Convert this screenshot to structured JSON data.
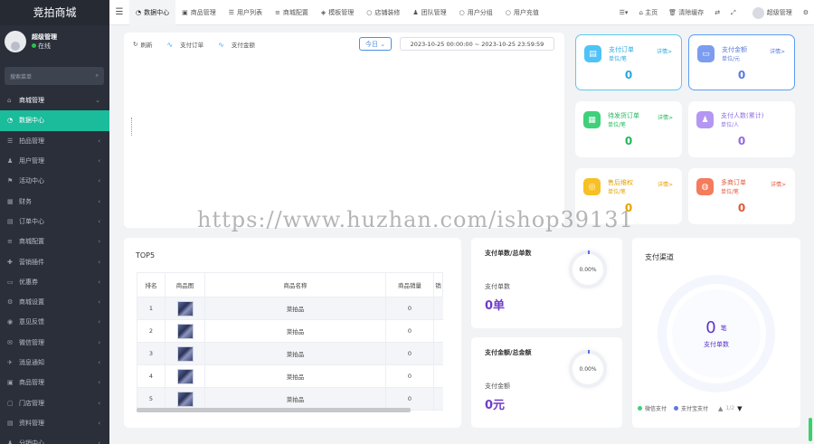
{
  "app": {
    "title": "竞拍商城"
  },
  "user": {
    "name": "超级管理",
    "status": "在线"
  },
  "sidebar": {
    "search_placeholder": "搜索菜单",
    "items": [
      {
        "icon": "home-icon",
        "glyph": "⌂",
        "label": "商城管理",
        "type": "head"
      },
      {
        "icon": "dashboard-icon",
        "glyph": "◔",
        "label": "数据中心",
        "type": "active"
      },
      {
        "icon": "list-icon",
        "glyph": "☰",
        "label": "拍品管理",
        "type": ""
      },
      {
        "icon": "user-icon",
        "glyph": "♟",
        "label": "用户管理",
        "type": ""
      },
      {
        "icon": "flag-icon",
        "glyph": "⚑",
        "label": "活动中心",
        "type": ""
      },
      {
        "icon": "grid-icon",
        "glyph": "▦",
        "label": "财务",
        "type": ""
      },
      {
        "icon": "file-icon",
        "glyph": "▤",
        "label": "订单中心",
        "type": ""
      },
      {
        "icon": "config-icon",
        "glyph": "≡",
        "label": "商城配置",
        "type": ""
      },
      {
        "icon": "gift-icon",
        "glyph": "✚",
        "label": "营销插件",
        "type": ""
      },
      {
        "icon": "ticket-icon",
        "glyph": "▭",
        "label": "优惠券",
        "type": ""
      },
      {
        "icon": "settings-icon",
        "glyph": "⚙",
        "label": "商城设置",
        "type": ""
      },
      {
        "icon": "feedback-icon",
        "glyph": "◉",
        "label": "意见反馈",
        "type": ""
      },
      {
        "icon": "wechat-icon",
        "glyph": "✉",
        "label": "微信管理",
        "type": ""
      },
      {
        "icon": "bell-icon",
        "glyph": "✈",
        "label": "消息通知",
        "type": ""
      },
      {
        "icon": "box-icon",
        "glyph": "▣",
        "label": "商品管理",
        "type": ""
      },
      {
        "icon": "store-icon",
        "glyph": "▢",
        "label": "门店管理",
        "type": ""
      },
      {
        "icon": "doc-icon",
        "glyph": "▤",
        "label": "资料管理",
        "type": ""
      },
      {
        "icon": "team-icon",
        "glyph": "♟",
        "label": "分销中心",
        "type": ""
      }
    ]
  },
  "topbar": {
    "tabs": [
      {
        "icon": "dashboard-icon",
        "glyph": "◔",
        "label": "数据中心",
        "active": true
      },
      {
        "icon": "box-icon",
        "glyph": "▣",
        "label": "商品管理"
      },
      {
        "icon": "list-icon",
        "glyph": "☰",
        "label": "用户列表"
      },
      {
        "icon": "sliders-icon",
        "glyph": "≡",
        "label": "商城配置"
      },
      {
        "icon": "template-icon",
        "glyph": "◈",
        "label": "模板管理"
      },
      {
        "icon": "circle-icon",
        "glyph": "○",
        "label": "店铺装修"
      },
      {
        "icon": "team-icon",
        "glyph": "♟",
        "label": "团队管理"
      },
      {
        "icon": "circle-icon",
        "glyph": "○",
        "label": "用户分组"
      },
      {
        "icon": "circle-icon",
        "glyph": "○",
        "label": "用户充值"
      }
    ],
    "home_label": "主页",
    "clear_cache_label": "清除缓存",
    "admin_label": "超级管理"
  },
  "chart": {
    "refresh_label": "刷新",
    "series1": "支付订单",
    "series2": "支付金额",
    "today_label": "今日",
    "date_range": "2023-10-25 00:00:00  ~  2023-10-25 23:59:59"
  },
  "stats": [
    {
      "title": "支付订单",
      "unit": "单位/笔",
      "detail": "详情>",
      "value": "0",
      "color": "#4fc3f7",
      "text_color": "#29a9e0",
      "glyph": "▤",
      "icon": "order-icon",
      "selected": "sel1"
    },
    {
      "title": "支付金额",
      "unit": "单位/元",
      "detail": "详情>",
      "value": "0",
      "color": "#7c9cf0",
      "text_color": "#5b7bdc",
      "glyph": "▭",
      "icon": "wallet-icon",
      "selected": "sel2"
    },
    {
      "title": "待发货订单",
      "unit": "单位/笔",
      "detail": "详情>",
      "value": "0",
      "color": "#3ed07a",
      "text_color": "#20b85c",
      "glyph": "▦",
      "icon": "shipping-icon",
      "selected": ""
    },
    {
      "title": "支付人数(累计)",
      "unit": "单位/人",
      "detail": "",
      "value": "0",
      "color": "#b497f2",
      "text_color": "#8f6be0",
      "glyph": "♟",
      "icon": "people-icon",
      "selected": ""
    },
    {
      "title": "售后维权",
      "unit": "单位/笔",
      "detail": "详情>",
      "value": "0",
      "color": "#f6c026",
      "text_color": "#e3a200",
      "glyph": "◎",
      "icon": "aftersale-icon",
      "selected": ""
    },
    {
      "title": "多商订单",
      "unit": "单位/笔",
      "detail": "详情>",
      "value": "0",
      "color": "#f47c5c",
      "text_color": "#e05a38",
      "glyph": "◍",
      "icon": "merchant-icon",
      "selected": ""
    }
  ],
  "top5": {
    "title": "TOP5",
    "columns": [
      "排名",
      "商品图",
      "商品名称",
      "商品销量",
      "销"
    ],
    "rows": [
      {
        "rank": "1",
        "name": "菜拍品",
        "sales": "0"
      },
      {
        "rank": "2",
        "name": "菜拍品",
        "sales": "0"
      },
      {
        "rank": "3",
        "name": "菜拍品",
        "sales": "0"
      },
      {
        "rank": "4",
        "name": "菜拍品",
        "sales": "0"
      },
      {
        "rank": "5",
        "name": "菜拍品",
        "sales": "0"
      }
    ]
  },
  "ratio_orders": {
    "title": "支付单数/总单数",
    "label": "支付单数",
    "value": "0单",
    "percent": "0.00%"
  },
  "ratio_amount": {
    "title": "支付金额/总金额",
    "label": "支付金额",
    "value": "0元",
    "percent": "0.00%"
  },
  "channel": {
    "title": "支付渠道",
    "value": "0",
    "unit": "笔",
    "label": "支付单数",
    "legend1": "微信支付",
    "legend1_color": "#3ed07a",
    "legend2": "支付宝支付",
    "legend2_color": "#5b7bdc",
    "page": "1/2"
  },
  "watermark": "https://www.huzhan.com/ishop39131"
}
